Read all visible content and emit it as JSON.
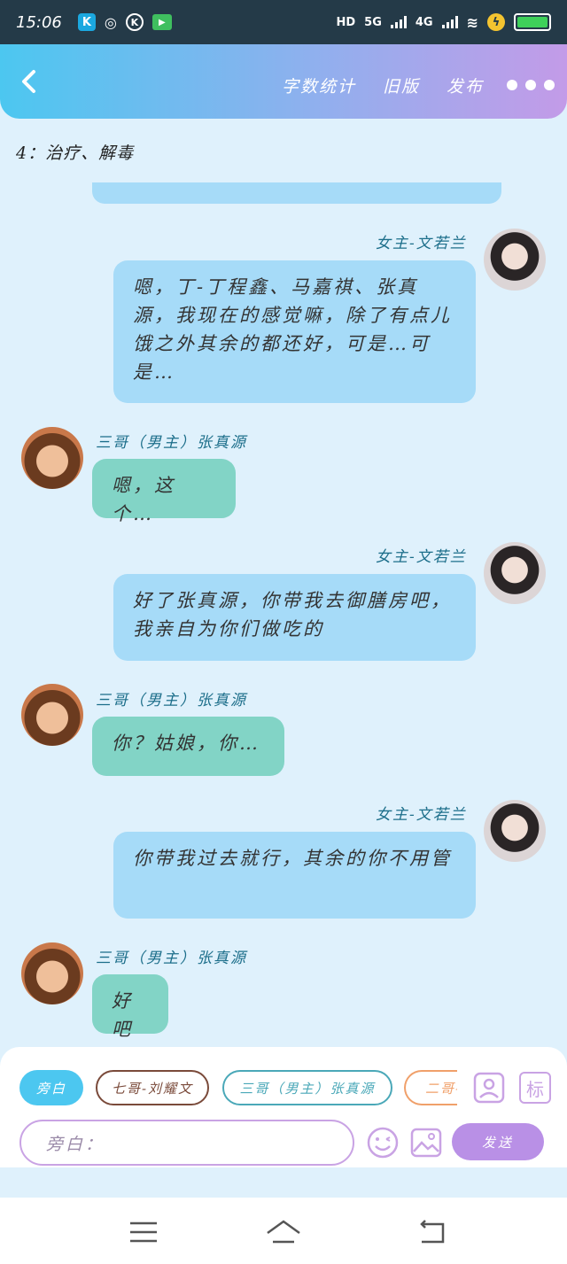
{
  "status": {
    "time": "15:06",
    "network": "5G",
    "network2": "4G",
    "hd": "HD"
  },
  "header": {
    "word_count": "字数统计",
    "old_version": "旧版",
    "publish": "发布"
  },
  "top_note": "4：治疗、解毒",
  "messages": [
    {
      "side": "right",
      "speaker": "女主-文若兰",
      "text": "嗯，丁-丁程鑫、马嘉祺、张真源，我现在的感觉嘛，除了有点儿饿之外其余的都还好，可是…可是…"
    },
    {
      "side": "left",
      "speaker": "三哥（男主）张真源",
      "text": "嗯，这个…"
    },
    {
      "side": "right",
      "speaker": "女主-文若兰",
      "text": "好了张真源，你带我去御膳房吧，我亲自为你们做吃的"
    },
    {
      "side": "left",
      "speaker": "三哥（男主）张真源",
      "text": "你？姑娘，你…"
    },
    {
      "side": "right",
      "speaker": "女主-文若兰",
      "text": "你带我过去就行，其余的你不用管"
    },
    {
      "side": "left",
      "speaker": "三哥（男主）张真源",
      "text": "好吧"
    }
  ],
  "composer": {
    "chips": [
      "旁白",
      "七哥-刘耀文",
      "三哥（男主）张真源",
      "二哥-"
    ],
    "placeholder": "旁白：",
    "send": "发送",
    "tag_icon_label": "标"
  },
  "colors": {
    "header_start": "#4cc7f0",
    "header_end": "#c39be8",
    "bubble_right": "#a6dbf8",
    "bubble_left": "#82d4c6",
    "send": "#b990e6"
  }
}
